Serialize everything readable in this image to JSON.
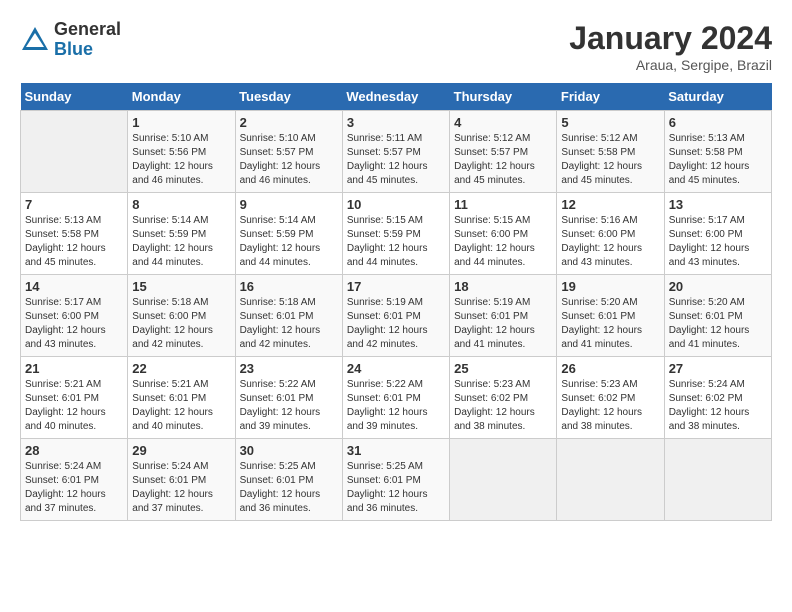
{
  "logo": {
    "general": "General",
    "blue": "Blue"
  },
  "title": {
    "month_year": "January 2024",
    "location": "Araua, Sergipe, Brazil"
  },
  "days_of_week": [
    "Sunday",
    "Monday",
    "Tuesday",
    "Wednesday",
    "Thursday",
    "Friday",
    "Saturday"
  ],
  "weeks": [
    [
      {
        "day": "",
        "info": ""
      },
      {
        "day": "1",
        "info": "Sunrise: 5:10 AM\nSunset: 5:56 PM\nDaylight: 12 hours\nand 46 minutes."
      },
      {
        "day": "2",
        "info": "Sunrise: 5:10 AM\nSunset: 5:57 PM\nDaylight: 12 hours\nand 46 minutes."
      },
      {
        "day": "3",
        "info": "Sunrise: 5:11 AM\nSunset: 5:57 PM\nDaylight: 12 hours\nand 45 minutes."
      },
      {
        "day": "4",
        "info": "Sunrise: 5:12 AM\nSunset: 5:57 PM\nDaylight: 12 hours\nand 45 minutes."
      },
      {
        "day": "5",
        "info": "Sunrise: 5:12 AM\nSunset: 5:58 PM\nDaylight: 12 hours\nand 45 minutes."
      },
      {
        "day": "6",
        "info": "Sunrise: 5:13 AM\nSunset: 5:58 PM\nDaylight: 12 hours\nand 45 minutes."
      }
    ],
    [
      {
        "day": "7",
        "info": "Sunrise: 5:13 AM\nSunset: 5:58 PM\nDaylight: 12 hours\nand 45 minutes."
      },
      {
        "day": "8",
        "info": "Sunrise: 5:14 AM\nSunset: 5:59 PM\nDaylight: 12 hours\nand 44 minutes."
      },
      {
        "day": "9",
        "info": "Sunrise: 5:14 AM\nSunset: 5:59 PM\nDaylight: 12 hours\nand 44 minutes."
      },
      {
        "day": "10",
        "info": "Sunrise: 5:15 AM\nSunset: 5:59 PM\nDaylight: 12 hours\nand 44 minutes."
      },
      {
        "day": "11",
        "info": "Sunrise: 5:15 AM\nSunset: 6:00 PM\nDaylight: 12 hours\nand 44 minutes."
      },
      {
        "day": "12",
        "info": "Sunrise: 5:16 AM\nSunset: 6:00 PM\nDaylight: 12 hours\nand 43 minutes."
      },
      {
        "day": "13",
        "info": "Sunrise: 5:17 AM\nSunset: 6:00 PM\nDaylight: 12 hours\nand 43 minutes."
      }
    ],
    [
      {
        "day": "14",
        "info": "Sunrise: 5:17 AM\nSunset: 6:00 PM\nDaylight: 12 hours\nand 43 minutes."
      },
      {
        "day": "15",
        "info": "Sunrise: 5:18 AM\nSunset: 6:00 PM\nDaylight: 12 hours\nand 42 minutes."
      },
      {
        "day": "16",
        "info": "Sunrise: 5:18 AM\nSunset: 6:01 PM\nDaylight: 12 hours\nand 42 minutes."
      },
      {
        "day": "17",
        "info": "Sunrise: 5:19 AM\nSunset: 6:01 PM\nDaylight: 12 hours\nand 42 minutes."
      },
      {
        "day": "18",
        "info": "Sunrise: 5:19 AM\nSunset: 6:01 PM\nDaylight: 12 hours\nand 41 minutes."
      },
      {
        "day": "19",
        "info": "Sunrise: 5:20 AM\nSunset: 6:01 PM\nDaylight: 12 hours\nand 41 minutes."
      },
      {
        "day": "20",
        "info": "Sunrise: 5:20 AM\nSunset: 6:01 PM\nDaylight: 12 hours\nand 41 minutes."
      }
    ],
    [
      {
        "day": "21",
        "info": "Sunrise: 5:21 AM\nSunset: 6:01 PM\nDaylight: 12 hours\nand 40 minutes."
      },
      {
        "day": "22",
        "info": "Sunrise: 5:21 AM\nSunset: 6:01 PM\nDaylight: 12 hours\nand 40 minutes."
      },
      {
        "day": "23",
        "info": "Sunrise: 5:22 AM\nSunset: 6:01 PM\nDaylight: 12 hours\nand 39 minutes."
      },
      {
        "day": "24",
        "info": "Sunrise: 5:22 AM\nSunset: 6:01 PM\nDaylight: 12 hours\nand 39 minutes."
      },
      {
        "day": "25",
        "info": "Sunrise: 5:23 AM\nSunset: 6:02 PM\nDaylight: 12 hours\nand 38 minutes."
      },
      {
        "day": "26",
        "info": "Sunrise: 5:23 AM\nSunset: 6:02 PM\nDaylight: 12 hours\nand 38 minutes."
      },
      {
        "day": "27",
        "info": "Sunrise: 5:24 AM\nSunset: 6:02 PM\nDaylight: 12 hours\nand 38 minutes."
      }
    ],
    [
      {
        "day": "28",
        "info": "Sunrise: 5:24 AM\nSunset: 6:01 PM\nDaylight: 12 hours\nand 37 minutes."
      },
      {
        "day": "29",
        "info": "Sunrise: 5:24 AM\nSunset: 6:01 PM\nDaylight: 12 hours\nand 37 minutes."
      },
      {
        "day": "30",
        "info": "Sunrise: 5:25 AM\nSunset: 6:01 PM\nDaylight: 12 hours\nand 36 minutes."
      },
      {
        "day": "31",
        "info": "Sunrise: 5:25 AM\nSunset: 6:01 PM\nDaylight: 12 hours\nand 36 minutes."
      },
      {
        "day": "",
        "info": ""
      },
      {
        "day": "",
        "info": ""
      },
      {
        "day": "",
        "info": ""
      }
    ]
  ]
}
